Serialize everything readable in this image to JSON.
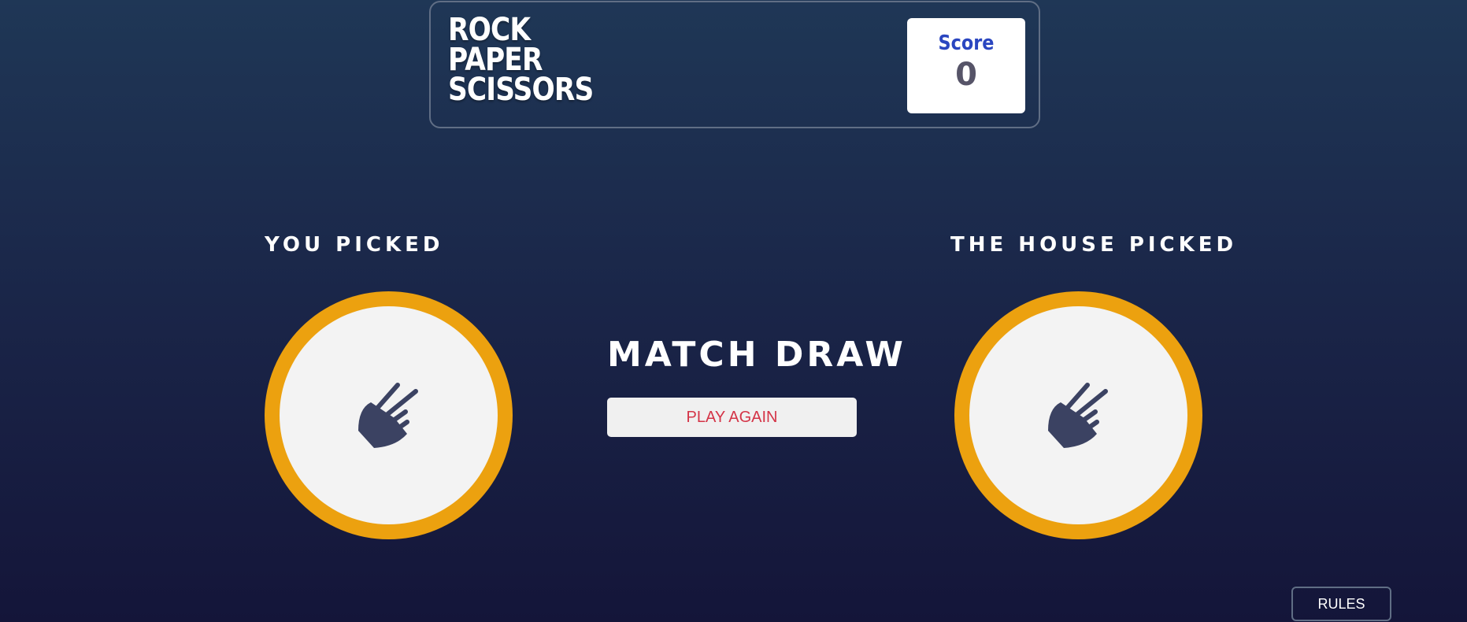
{
  "header": {
    "title_lines": [
      "ROCK",
      "PAPER",
      "SCISSORS"
    ],
    "score_label": "Score",
    "score_value": "0"
  },
  "player": {
    "label": "YOU PICKED",
    "choice_icon": "scissors-icon"
  },
  "house": {
    "label": "THE HOUSE PICKED",
    "choice_icon": "scissors-icon"
  },
  "result": {
    "text": "MATCH DRAW",
    "play_again_label": "PLAY AGAIN"
  },
  "footer": {
    "rules_label": "RULES"
  },
  "colors": {
    "token_ring": "#eca10f",
    "score_label": "#2a46c0",
    "play_again_text": "#d43447",
    "icon": "#3b4262"
  }
}
